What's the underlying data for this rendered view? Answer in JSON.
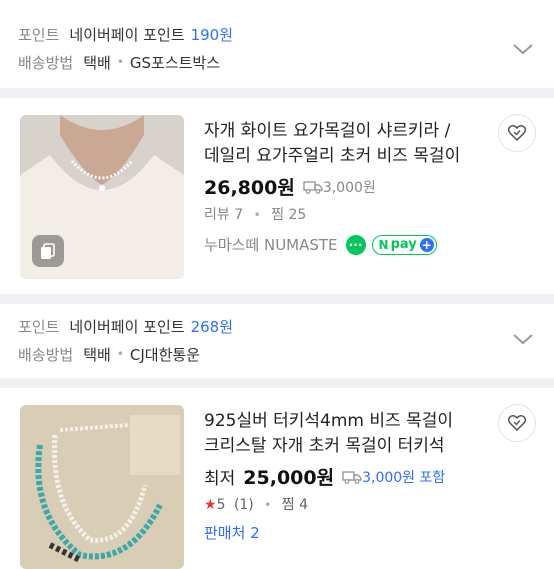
{
  "section1": {
    "point_label": "포인트",
    "point_value": "네이버페이 포인트",
    "point_amount": "190원",
    "delivery_label": "배송방법",
    "delivery_type": "택배",
    "delivery_company": "GS포스트박스"
  },
  "product1": {
    "title_line1": "자개 화이트 요가목걸이 샤르키라 /",
    "title_line2": "데일리 요가주얼리 초커 비즈 목걸이",
    "price": "26,800원",
    "shipping": "3,000원",
    "reviews": "리뷰 7",
    "wishes": "찜 25",
    "seller": "누마스떼 NUMASTE",
    "npay": "pay"
  },
  "section2": {
    "point_label": "포인트",
    "point_value": "네이버페이 포인트",
    "point_amount": "268원",
    "delivery_label": "배송방법",
    "delivery_type": "택배",
    "delivery_company": "CJ대한통운"
  },
  "product2": {
    "title_line1": "925실버 터키석4mm 비즈 목걸이",
    "title_line2": "크리스탈 자개 초커 목걸이 터키석",
    "price_prefix": "최저",
    "price": "25,000원",
    "shipping": "3,000원 포함",
    "rating": "5",
    "rating_count": "(1)",
    "wishes": "찜 4",
    "sellers": "판매처 2"
  },
  "colors": {
    "accent": "#2f6fff",
    "naver_green": "#03c75a",
    "star": "#e8372c"
  }
}
